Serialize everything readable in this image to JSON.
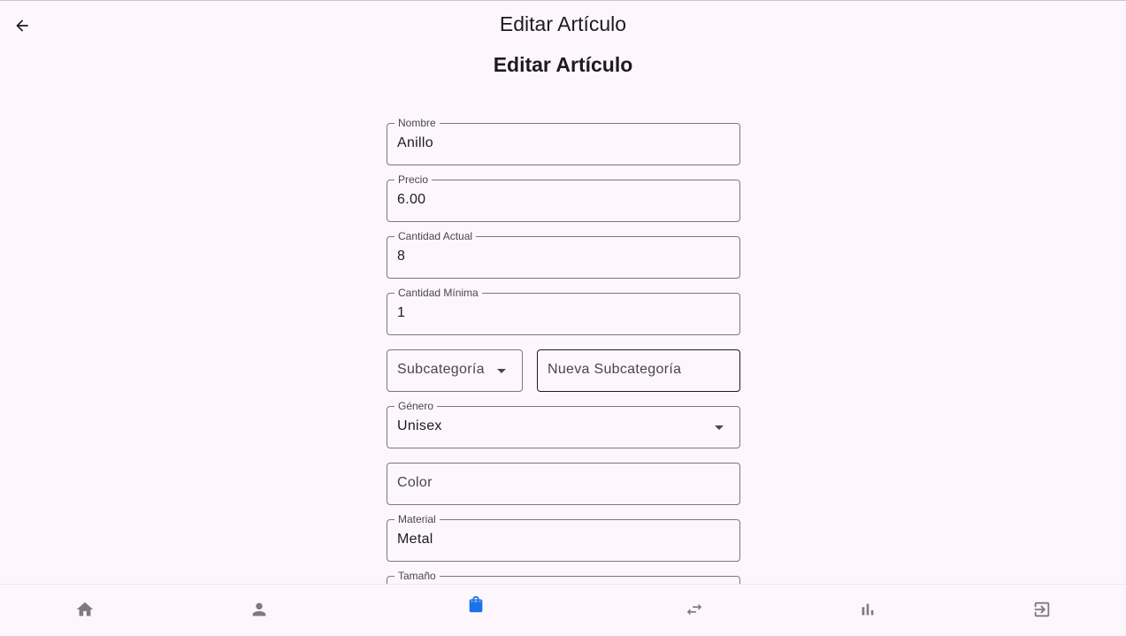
{
  "appbar": {
    "title": "Editar Artículo",
    "back_icon": "arrow-back-icon"
  },
  "page": {
    "heading": "Editar Artículo"
  },
  "form": {
    "nombre": {
      "label": "Nombre",
      "value": "Anillo"
    },
    "precio": {
      "label": "Precio",
      "value": "6.00"
    },
    "cantidad_actual": {
      "label": "Cantidad Actual",
      "value": "8"
    },
    "cantidad_minima": {
      "label": "Cantidad Mínima",
      "value": "1"
    },
    "subcategoria": {
      "placeholder": "Subcategoría"
    },
    "nueva_subcategoria": {
      "placeholder": "Nueva Subcategoría"
    },
    "genero": {
      "label": "Género",
      "value": "Unisex"
    },
    "color": {
      "placeholder": "Color"
    },
    "material": {
      "label": "Material",
      "value": "Metal"
    },
    "tamano": {
      "label": "Tamaño",
      "value": ""
    }
  },
  "bottom_nav": {
    "items": [
      {
        "icon": "home-icon",
        "active": false
      },
      {
        "icon": "person-icon",
        "active": false
      },
      {
        "icon": "shopping-bag-icon",
        "active": true
      },
      {
        "icon": "swap-horiz-icon",
        "active": false
      },
      {
        "icon": "bar-chart-icon",
        "active": false
      },
      {
        "icon": "logout-icon",
        "active": false
      }
    ]
  },
  "colors": {
    "background": "#fdf7fd",
    "accent": "#1a73e8",
    "inactive_icon": "#7d7a80",
    "outline": "#7b7680"
  }
}
